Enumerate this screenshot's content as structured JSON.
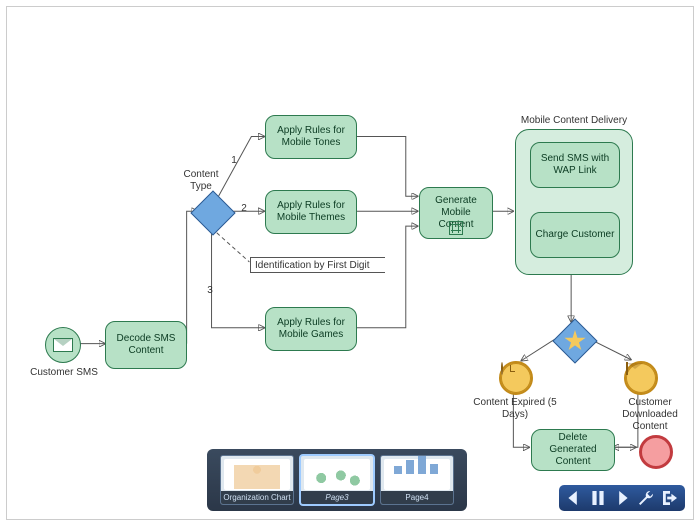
{
  "start": {
    "label": "Customer SMS",
    "icon": "envelope-icon"
  },
  "tasks": {
    "decode": {
      "label": "Decode SMS Content"
    },
    "rules_tones": {
      "label": "Apply Rules for Mobile Tones"
    },
    "rules_themes": {
      "label": "Apply Rules for Mobile Themes"
    },
    "rules_games": {
      "label": "Apply Rules for Mobile Games"
    },
    "generate": {
      "label": "Generate Mobile Content"
    },
    "delete": {
      "label": "Delete Generated Content"
    }
  },
  "subprocess": {
    "title": "Mobile Content Delivery",
    "tasks": {
      "send_sms": {
        "label": "Send SMS with WAP Link"
      },
      "charge": {
        "label": "Charge Customer"
      }
    }
  },
  "gateway": {
    "content_type": {
      "label": "Content Type",
      "branches": [
        "1",
        "2",
        "3"
      ]
    },
    "annotation": "Identification by First Digit"
  },
  "intermediate_events": {
    "expired": {
      "label": "Content Expired (5 Days)",
      "icon": "clock-icon"
    },
    "downloaded": {
      "label": "Customer Downloaded Content",
      "icon": "envelope-icon"
    }
  },
  "tray": {
    "slides": [
      {
        "caption": "Organization Chart",
        "selected": false
      },
      {
        "caption": "Page3",
        "selected": true
      },
      {
        "caption": "Page4",
        "selected": false
      }
    ]
  },
  "toolbar": {
    "buttons": [
      {
        "name": "nav-prev",
        "icon": "arrow-left-icon"
      },
      {
        "name": "nav-pause",
        "icon": "pause-icon"
      },
      {
        "name": "nav-next",
        "icon": "arrow-right-icon"
      },
      {
        "name": "settings",
        "icon": "wrench-icon"
      },
      {
        "name": "exit",
        "icon": "exit-icon"
      }
    ]
  }
}
